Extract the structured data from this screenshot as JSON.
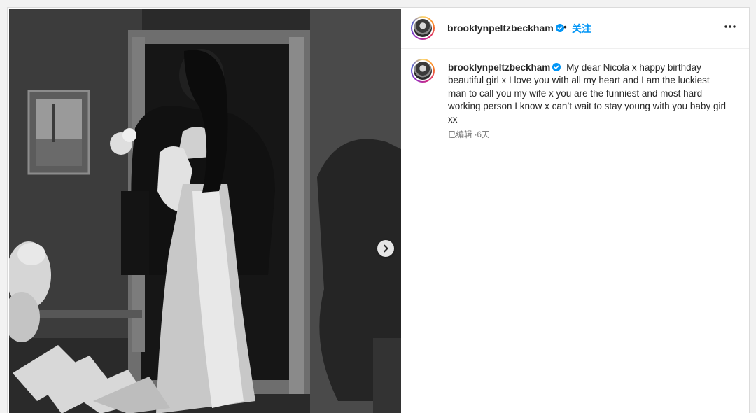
{
  "post": {
    "username": "brooklynpeltzbeckham",
    "separator": "•",
    "follow_label": "关注",
    "more_icon": "more-horizontal-icon",
    "verified_color": "#0095f6",
    "caption": "My dear Nicola x happy birthday beautiful girl x I love you with all my heart and I am the luckiest man to call you my wife x you are the funniest and most hard working person I know x can’t wait to stay young with you baby girl xx",
    "edited_label": "已编辑",
    "time_sep": "·",
    "time_ago": "6天"
  },
  "media": {
    "next_icon": "chevron-right-icon"
  }
}
